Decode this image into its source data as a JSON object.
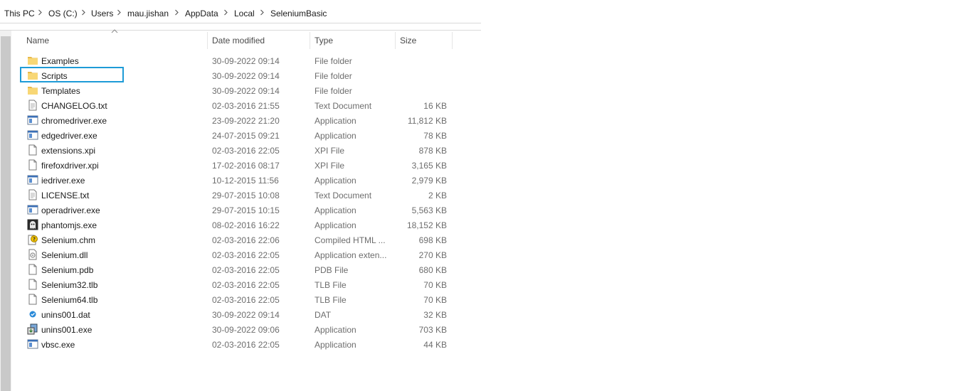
{
  "breadcrumb": [
    "This PC",
    "OS (C:)",
    "Users",
    "mau.jishan",
    "AppData",
    "Local",
    "SeleniumBasic"
  ],
  "columns": {
    "name": "Name",
    "date": "Date modified",
    "type": "Type",
    "size": "Size"
  },
  "colors": {
    "selection_border": "#1e9bd7",
    "folder": "#f8d775"
  },
  "files": [
    {
      "name": "Examples",
      "date": "30-09-2022 09:14",
      "type": "File folder",
      "size": "",
      "icon": "folder-icon"
    },
    {
      "name": "Scripts",
      "date": "30-09-2022 09:14",
      "type": "File folder",
      "size": "",
      "icon": "folder-icon"
    },
    {
      "name": "Templates",
      "date": "30-09-2022 09:14",
      "type": "File folder",
      "size": "",
      "icon": "folder-icon"
    },
    {
      "name": "CHANGELOG.txt",
      "date": "02-03-2016 21:55",
      "type": "Text Document",
      "size": "16 KB",
      "icon": "text-file-icon"
    },
    {
      "name": "chromedriver.exe",
      "date": "23-09-2022 21:20",
      "type": "Application",
      "size": "11,812 KB",
      "icon": "application-icon"
    },
    {
      "name": "edgedriver.exe",
      "date": "24-07-2015 09:21",
      "type": "Application",
      "size": "78 KB",
      "icon": "application-icon"
    },
    {
      "name": "extensions.xpi",
      "date": "02-03-2016 22:05",
      "type": "XPI File",
      "size": "878 KB",
      "icon": "blank-file-icon"
    },
    {
      "name": "firefoxdriver.xpi",
      "date": "17-02-2016 08:17",
      "type": "XPI File",
      "size": "3,165 KB",
      "icon": "blank-file-icon"
    },
    {
      "name": "iedriver.exe",
      "date": "10-12-2015 11:56",
      "type": "Application",
      "size": "2,979 KB",
      "icon": "application-icon"
    },
    {
      "name": "LICENSE.txt",
      "date": "29-07-2015 10:08",
      "type": "Text Document",
      "size": "2 KB",
      "icon": "text-file-icon"
    },
    {
      "name": "operadriver.exe",
      "date": "29-07-2015 10:15",
      "type": "Application",
      "size": "5,563 KB",
      "icon": "application-icon"
    },
    {
      "name": "phantomjs.exe",
      "date": "08-02-2016 16:22",
      "type": "Application",
      "size": "18,152 KB",
      "icon": "ghost-icon"
    },
    {
      "name": "Selenium.chm",
      "date": "02-03-2016 22:06",
      "type": "Compiled HTML ...",
      "size": "698 KB",
      "icon": "help-file-icon"
    },
    {
      "name": "Selenium.dll",
      "date": "02-03-2016 22:05",
      "type": "Application exten...",
      "size": "270 KB",
      "icon": "dll-file-icon"
    },
    {
      "name": "Selenium.pdb",
      "date": "02-03-2016 22:05",
      "type": "PDB File",
      "size": "680 KB",
      "icon": "blank-file-icon"
    },
    {
      "name": "Selenium32.tlb",
      "date": "02-03-2016 22:05",
      "type": "TLB File",
      "size": "70 KB",
      "icon": "blank-file-icon"
    },
    {
      "name": "Selenium64.tlb",
      "date": "02-03-2016 22:05",
      "type": "TLB File",
      "size": "70 KB",
      "icon": "blank-file-icon"
    },
    {
      "name": "unins001.dat",
      "date": "30-09-2022 09:14",
      "type": "DAT",
      "size": "32 KB",
      "icon": "dat-file-icon"
    },
    {
      "name": "unins001.exe",
      "date": "30-09-2022 09:06",
      "type": "Application",
      "size": "703 KB",
      "icon": "installer-icon"
    },
    {
      "name": "vbsc.exe",
      "date": "02-03-2016 22:05",
      "type": "Application",
      "size": "44 KB",
      "icon": "application-icon"
    }
  ]
}
